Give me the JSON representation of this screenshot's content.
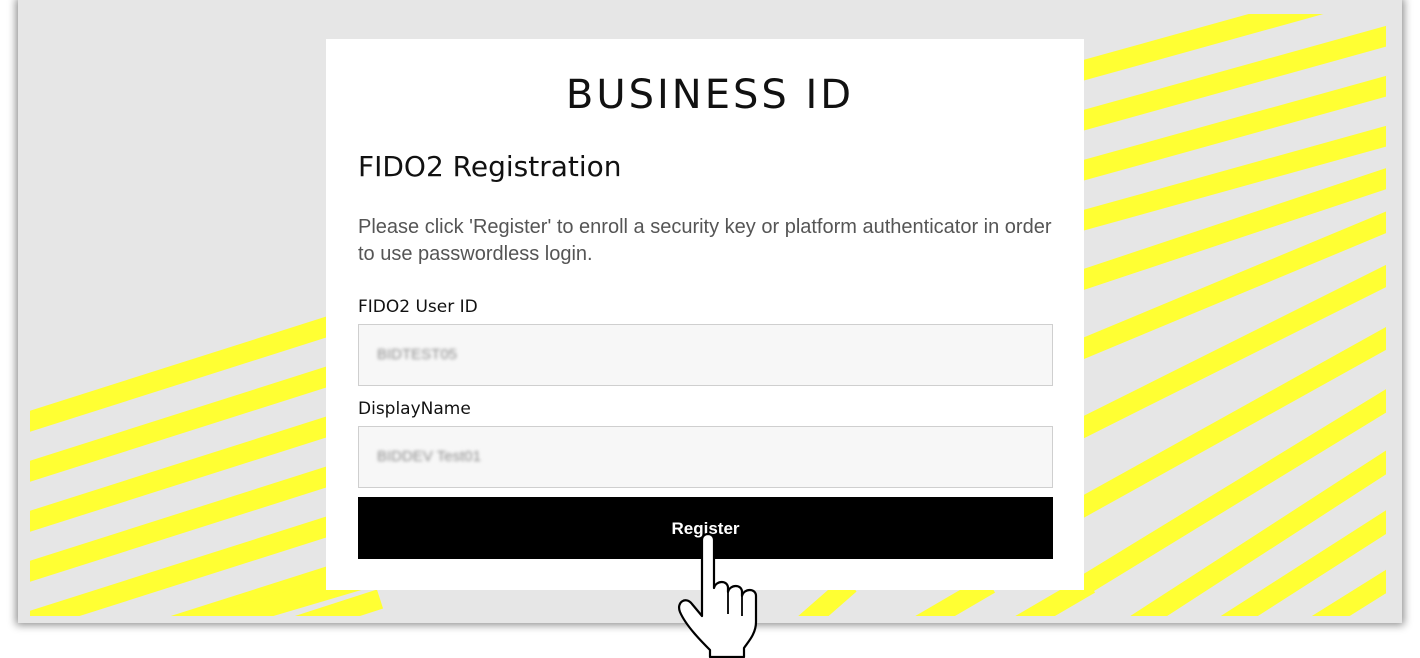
{
  "brand": {
    "title": "BUSINESS ID"
  },
  "page": {
    "title": "FIDO2 Registration",
    "description": "Please click 'Register' to enroll a security key or platform authenticator in order to use passwordless login."
  },
  "form": {
    "user_id_label": "FIDO2 User ID",
    "user_id_value": "BIDTEST05",
    "display_name_label": "DisplayName",
    "display_name_value": "BIDDEV Test01",
    "register_label": "Register"
  },
  "colors": {
    "stripe": "#ffff33",
    "background": "#e6e6e6",
    "button": "#000000"
  },
  "icons": {
    "pointer": "hand-pointer-icon"
  }
}
